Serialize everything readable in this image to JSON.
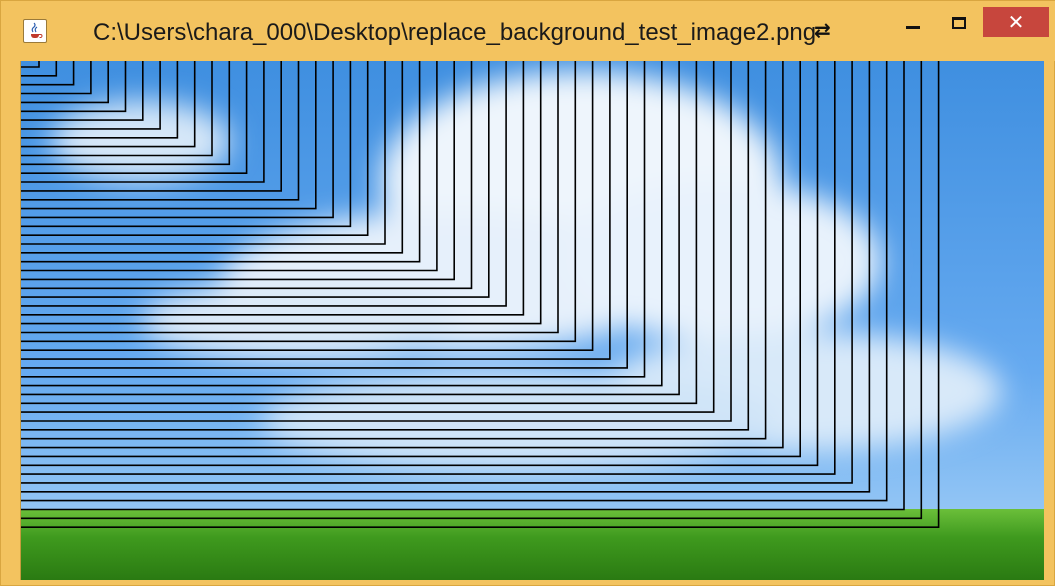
{
  "window": {
    "title": "C:\\Users\\chara_000\\Desktop\\replace_background_test_image2.png",
    "app_icon": "java-cup-icon",
    "resize_icon": "resize-horizontal-icon",
    "controls": {
      "minimize_icon": "minimize-icon",
      "maximize_icon": "maximize-icon",
      "close_label": "✕",
      "close_color": "#c7463d"
    },
    "frame_color": "#f3c35f"
  },
  "canvas": {
    "image": "sky-clouds-grass-background",
    "sky_color": "#4a97e6",
    "cloud_color": "#f4f8fc",
    "grass_color": "#3f9a1e",
    "line_color": "#000000",
    "nested_line_count": 53
  }
}
